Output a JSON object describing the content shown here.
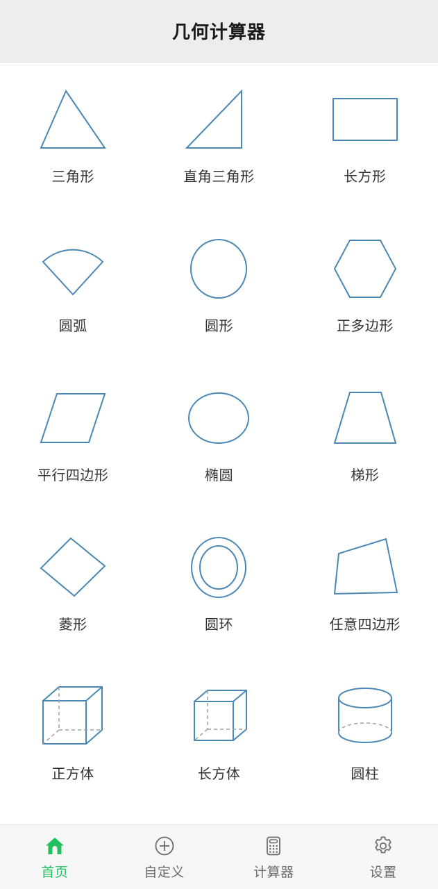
{
  "header": {
    "title": "几何计算器"
  },
  "theme": {
    "shape_stroke": "#4a87b5",
    "shape_hidden_stroke": "#9aa0a6",
    "header_bg": "#ededed",
    "nav_bg": "#f6f6f6",
    "active_color": "#22bf5e",
    "label_color": "#333333",
    "nav_label_color": "#6b6b6b"
  },
  "grid": {
    "items": [
      {
        "label": "三角形",
        "icon": "triangle-icon"
      },
      {
        "label": "直角三角形",
        "icon": "right-triangle-icon"
      },
      {
        "label": "长方形",
        "icon": "rectangle-icon"
      },
      {
        "label": "圆弧",
        "icon": "sector-icon"
      },
      {
        "label": "圆形",
        "icon": "circle-icon"
      },
      {
        "label": "正多边形",
        "icon": "hexagon-icon"
      },
      {
        "label": "平行四边形",
        "icon": "parallelogram-icon"
      },
      {
        "label": "椭圆",
        "icon": "ellipse-icon"
      },
      {
        "label": "梯形",
        "icon": "trapezoid-icon"
      },
      {
        "label": "菱形",
        "icon": "rhombus-icon"
      },
      {
        "label": "圆环",
        "icon": "annulus-icon"
      },
      {
        "label": "任意四边形",
        "icon": "quadrilateral-icon"
      },
      {
        "label": "正方体",
        "icon": "cube-icon"
      },
      {
        "label": "长方体",
        "icon": "cuboid-icon"
      },
      {
        "label": "圆柱",
        "icon": "cylinder-icon"
      }
    ]
  },
  "navbar": {
    "items": [
      {
        "label": "首页",
        "icon": "home-icon",
        "active": true
      },
      {
        "label": "自定义",
        "icon": "plus-circle-icon",
        "active": false
      },
      {
        "label": "计算器",
        "icon": "calculator-icon",
        "active": false
      },
      {
        "label": "设置",
        "icon": "gear-icon",
        "active": false
      }
    ]
  }
}
